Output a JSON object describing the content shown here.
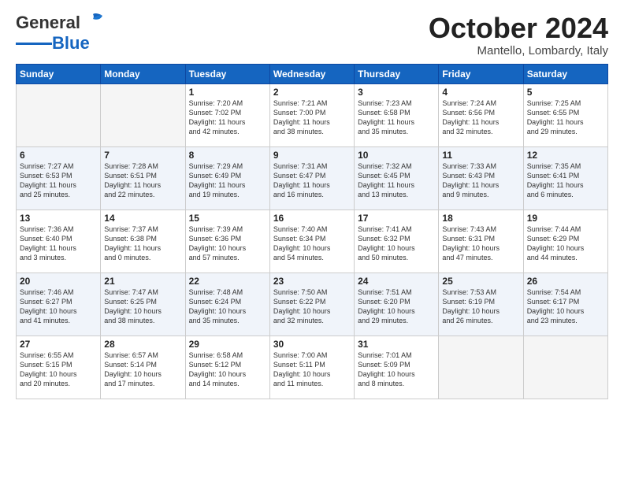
{
  "header": {
    "logo_general": "General",
    "logo_blue": "Blue",
    "month": "October 2024",
    "location": "Mantello, Lombardy, Italy"
  },
  "weekdays": [
    "Sunday",
    "Monday",
    "Tuesday",
    "Wednesday",
    "Thursday",
    "Friday",
    "Saturday"
  ],
  "weeks": [
    [
      {
        "day": "",
        "info": ""
      },
      {
        "day": "",
        "info": ""
      },
      {
        "day": "1",
        "info": "Sunrise: 7:20 AM\nSunset: 7:02 PM\nDaylight: 11 hours\nand 42 minutes."
      },
      {
        "day": "2",
        "info": "Sunrise: 7:21 AM\nSunset: 7:00 PM\nDaylight: 11 hours\nand 38 minutes."
      },
      {
        "day": "3",
        "info": "Sunrise: 7:23 AM\nSunset: 6:58 PM\nDaylight: 11 hours\nand 35 minutes."
      },
      {
        "day": "4",
        "info": "Sunrise: 7:24 AM\nSunset: 6:56 PM\nDaylight: 11 hours\nand 32 minutes."
      },
      {
        "day": "5",
        "info": "Sunrise: 7:25 AM\nSunset: 6:55 PM\nDaylight: 11 hours\nand 29 minutes."
      }
    ],
    [
      {
        "day": "6",
        "info": "Sunrise: 7:27 AM\nSunset: 6:53 PM\nDaylight: 11 hours\nand 25 minutes."
      },
      {
        "day": "7",
        "info": "Sunrise: 7:28 AM\nSunset: 6:51 PM\nDaylight: 11 hours\nand 22 minutes."
      },
      {
        "day": "8",
        "info": "Sunrise: 7:29 AM\nSunset: 6:49 PM\nDaylight: 11 hours\nand 19 minutes."
      },
      {
        "day": "9",
        "info": "Sunrise: 7:31 AM\nSunset: 6:47 PM\nDaylight: 11 hours\nand 16 minutes."
      },
      {
        "day": "10",
        "info": "Sunrise: 7:32 AM\nSunset: 6:45 PM\nDaylight: 11 hours\nand 13 minutes."
      },
      {
        "day": "11",
        "info": "Sunrise: 7:33 AM\nSunset: 6:43 PM\nDaylight: 11 hours\nand 9 minutes."
      },
      {
        "day": "12",
        "info": "Sunrise: 7:35 AM\nSunset: 6:41 PM\nDaylight: 11 hours\nand 6 minutes."
      }
    ],
    [
      {
        "day": "13",
        "info": "Sunrise: 7:36 AM\nSunset: 6:40 PM\nDaylight: 11 hours\nand 3 minutes."
      },
      {
        "day": "14",
        "info": "Sunrise: 7:37 AM\nSunset: 6:38 PM\nDaylight: 11 hours\nand 0 minutes."
      },
      {
        "day": "15",
        "info": "Sunrise: 7:39 AM\nSunset: 6:36 PM\nDaylight: 10 hours\nand 57 minutes."
      },
      {
        "day": "16",
        "info": "Sunrise: 7:40 AM\nSunset: 6:34 PM\nDaylight: 10 hours\nand 54 minutes."
      },
      {
        "day": "17",
        "info": "Sunrise: 7:41 AM\nSunset: 6:32 PM\nDaylight: 10 hours\nand 50 minutes."
      },
      {
        "day": "18",
        "info": "Sunrise: 7:43 AM\nSunset: 6:31 PM\nDaylight: 10 hours\nand 47 minutes."
      },
      {
        "day": "19",
        "info": "Sunrise: 7:44 AM\nSunset: 6:29 PM\nDaylight: 10 hours\nand 44 minutes."
      }
    ],
    [
      {
        "day": "20",
        "info": "Sunrise: 7:46 AM\nSunset: 6:27 PM\nDaylight: 10 hours\nand 41 minutes."
      },
      {
        "day": "21",
        "info": "Sunrise: 7:47 AM\nSunset: 6:25 PM\nDaylight: 10 hours\nand 38 minutes."
      },
      {
        "day": "22",
        "info": "Sunrise: 7:48 AM\nSunset: 6:24 PM\nDaylight: 10 hours\nand 35 minutes."
      },
      {
        "day": "23",
        "info": "Sunrise: 7:50 AM\nSunset: 6:22 PM\nDaylight: 10 hours\nand 32 minutes."
      },
      {
        "day": "24",
        "info": "Sunrise: 7:51 AM\nSunset: 6:20 PM\nDaylight: 10 hours\nand 29 minutes."
      },
      {
        "day": "25",
        "info": "Sunrise: 7:53 AM\nSunset: 6:19 PM\nDaylight: 10 hours\nand 26 minutes."
      },
      {
        "day": "26",
        "info": "Sunrise: 7:54 AM\nSunset: 6:17 PM\nDaylight: 10 hours\nand 23 minutes."
      }
    ],
    [
      {
        "day": "27",
        "info": "Sunrise: 6:55 AM\nSunset: 5:15 PM\nDaylight: 10 hours\nand 20 minutes."
      },
      {
        "day": "28",
        "info": "Sunrise: 6:57 AM\nSunset: 5:14 PM\nDaylight: 10 hours\nand 17 minutes."
      },
      {
        "day": "29",
        "info": "Sunrise: 6:58 AM\nSunset: 5:12 PM\nDaylight: 10 hours\nand 14 minutes."
      },
      {
        "day": "30",
        "info": "Sunrise: 7:00 AM\nSunset: 5:11 PM\nDaylight: 10 hours\nand 11 minutes."
      },
      {
        "day": "31",
        "info": "Sunrise: 7:01 AM\nSunset: 5:09 PM\nDaylight: 10 hours\nand 8 minutes."
      },
      {
        "day": "",
        "info": ""
      },
      {
        "day": "",
        "info": ""
      }
    ]
  ]
}
